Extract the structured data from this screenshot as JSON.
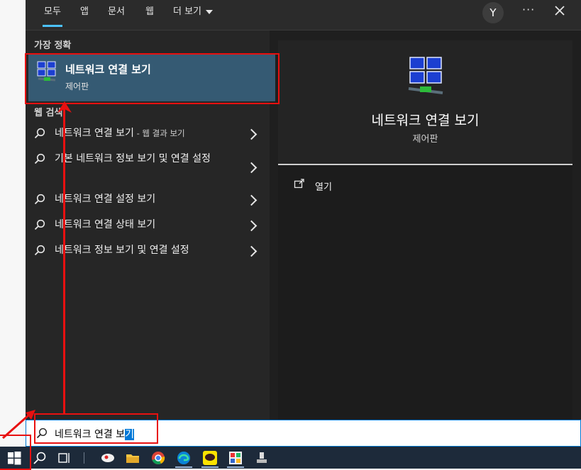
{
  "tabs": [
    {
      "label": "모두",
      "active": true
    },
    {
      "label": "앱"
    },
    {
      "label": "문서"
    },
    {
      "label": "웹"
    },
    {
      "label": "더 보기"
    }
  ],
  "header": {
    "avatar_letter": "Y",
    "more_label": "···"
  },
  "best_match": {
    "section_label": "가장 정확",
    "title": "네트워크 연결 보기",
    "subtitle": "제어판"
  },
  "web_search": {
    "section_label": "웹 검색",
    "items": [
      {
        "label": "네트워크 연결 보기",
        "suffix": " - 웹 결과 보기"
      },
      {
        "label": "기본 네트워크 정보 보기 및 연결 설정"
      },
      {
        "label": "네트워크 연결 설정 보기"
      },
      {
        "label": "네트워크 연결 상태 보기"
      },
      {
        "label": "네트워크 정보 보기 및 연결 설정"
      }
    ]
  },
  "detail": {
    "title": "네트워크 연결 보기",
    "subtitle": "제어판",
    "actions": [
      {
        "label": "열기"
      }
    ]
  },
  "search": {
    "typed": "네트워크 연결 보",
    "selected": "기"
  },
  "colors": {
    "accent": "#4cc2ff",
    "highlight": "#355a73",
    "annotation": "#e81010"
  }
}
